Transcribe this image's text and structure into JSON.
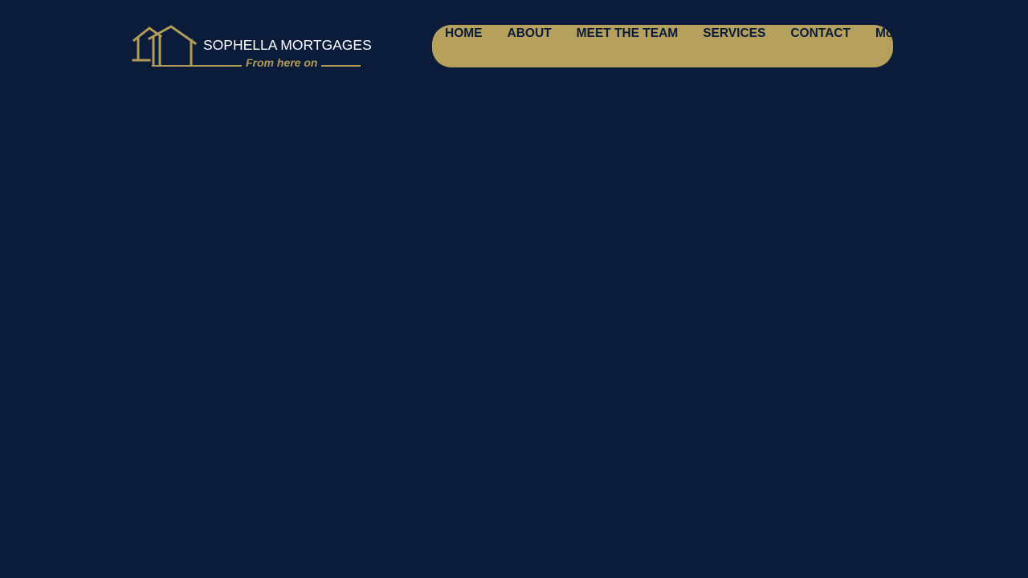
{
  "header": {
    "logo": {
      "brand_name": "SOPHELLA MORTGAGES",
      "tagline": "From here on",
      "icon": "houses-outline-icon"
    },
    "nav": {
      "items": [
        {
          "label": "HOME"
        },
        {
          "label": "ABOUT"
        },
        {
          "label": "MEET THE TEAM"
        },
        {
          "label": "SERVICES"
        },
        {
          "label": "CONTACT"
        },
        {
          "label": "More"
        }
      ]
    }
  },
  "colors": {
    "background": "#0b1b3a",
    "accent_gold": "#b6a05e",
    "text_light": "#ffffff"
  }
}
